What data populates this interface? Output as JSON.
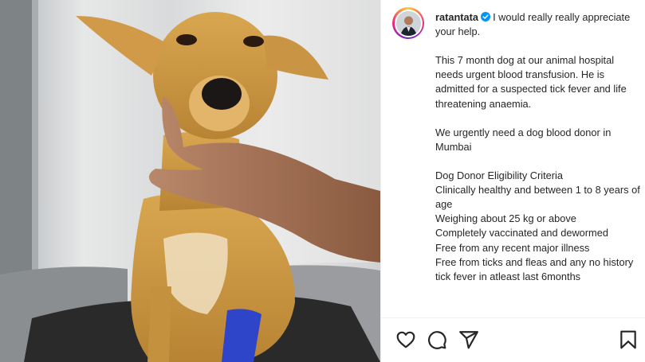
{
  "post": {
    "username": "ratantata",
    "verified": true,
    "caption_first": "I would really really appreciate your help.",
    "caption_paragraphs": [
      "This 7 month dog at our animal hospital needs urgent blood transfusion. He is admitted for a suspected tick fever and life threatening anaemia.",
      "We urgently need a dog blood donor in Mumbai"
    ],
    "criteria_title": "Dog Donor Eligibility Criteria",
    "criteria": [
      "Clinically healthy and between 1 to 8 years of age",
      "Weighing about 25 kg or above",
      "Completely vaccinated and dewormed",
      "Free from any recent major illness",
      "Free from ticks and fleas and any no history tick fever in atleast last 6months"
    ]
  },
  "icons": {
    "like": "heart-icon",
    "comment": "comment-icon",
    "share": "paper-plane-icon",
    "save": "bookmark-icon",
    "verified": "verified-badge-icon"
  },
  "colors": {
    "verified_blue": "#0095f6",
    "text": "#262626",
    "bandage_blue": "#2f45c9"
  }
}
